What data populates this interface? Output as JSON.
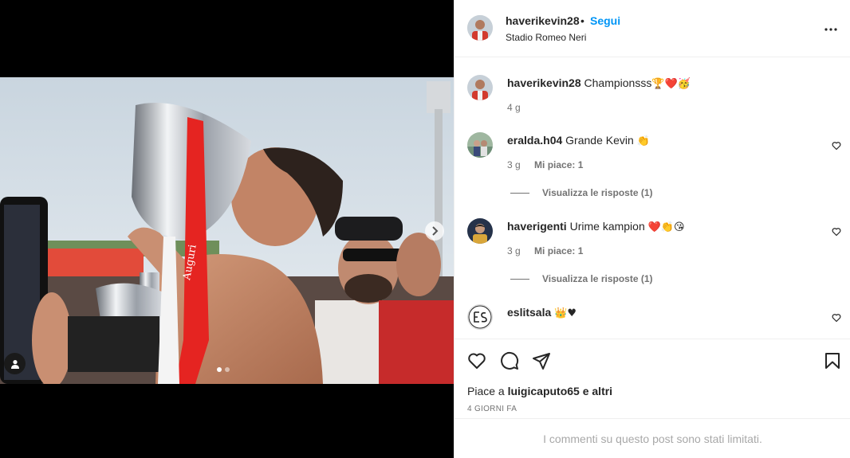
{
  "post": {
    "username": "haverikevin28",
    "follow_label": "Segui",
    "separator": "•",
    "location": "Stadio Romeo Neri"
  },
  "caption": {
    "username": "haverikevin28",
    "text": "Championsss",
    "emojis": "🏆❤️🥳",
    "time": "4 g"
  },
  "comments": [
    {
      "username": "eralda.h04",
      "text": "Grande Kevin",
      "emojis": "👏",
      "time": "3 g",
      "likes": "Mi piace: 1",
      "replies": "Visualizza le risposte (1)"
    },
    {
      "username": "haverigenti",
      "text": "Urime kampion",
      "emojis": "❤️👏😘",
      "time": "3 g",
      "likes": "Mi piace: 1",
      "replies": "Visualizza le risposte (1)"
    },
    {
      "username": "eslitsala",
      "text": "",
      "emojis": "👑♥"
    }
  ],
  "actions": {
    "liked_by_prefix": "Piace a",
    "liked_by_user": "luigicaputo65",
    "liked_by_suffix": "e altri",
    "date": "4 GIORNI FA"
  },
  "comments_limited": "I commenti su questo post sono stati limitati.",
  "colors": {
    "accent": "#0095f6",
    "text": "#262626",
    "secondary": "#737373",
    "border": "#efefef",
    "ribbon": "#e52421"
  },
  "media": {
    "photo_text": "Auguri",
    "carousel_index": 1,
    "carousel_total": 2
  }
}
